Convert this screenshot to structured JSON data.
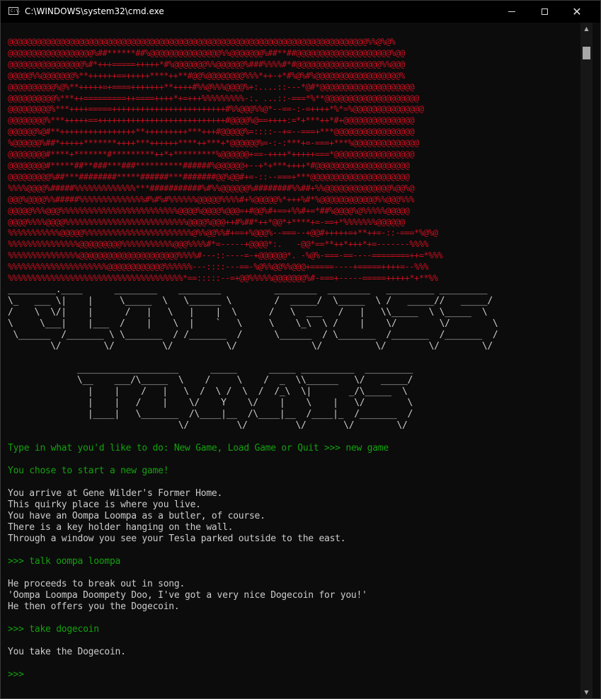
{
  "window": {
    "title": "C:\\WINDOWS\\system32\\cmd.exe",
    "app_icon_text": "C:\\."
  },
  "colors": {
    "art": "#c50f1f",
    "prompt": "#13a10e",
    "text": "#cccccc",
    "background": "#0c0c0c"
  },
  "art": "@@@@@@@@@@@@@@@@@@@@@@@@@@@@@@@@@@@@@@@@@@@@@@@@@@@@@@@@@@@@@@@@@@@@@@@@@@@@%%@%@%\n@@@@@@@@@@@@@@@@@@%##******##%@@@@@@@@@@@@@@@%%@@@@@@@%##**##@@@@@@@@@@@@@@@@@@@@%@@\n@@@@@@@@@@@@@@@@%#*+++=====+++++*#%@@@@@@@%%@@@@@@%###%%%%#*#@@@@@@@@@@@@@@@@@@%%@@@\n@@@@@%%@@@@@@@%**++++++==+++++****++**#@@%@@@@@@@@%%%*++-+*#%@%#%@@@@@@@@@@@@@@@@@@%\n@@@@@@@@@@%@%**+++++=+====+++++++**++++#%%@%%%@@@@%+:....::---*@#*@@@@@@@@@@@@@@@@@@@@\n@@@@@@@@@@%***++=========++====++++*+=+++%%%%%%%%%-:. ...::-===*%**@@@@@@@@@@@@@@@@@@@@\n@@@@@@@@@%***++++=====++++++++++++++++++++++++#%%@@@%%@*--==-:-=++++*%*=%@@@@@@@@@@@@@@@\n@@@@@@@@%***+++++==+++++++++++++++++++++++++++#@@@@%@==++++:=*+***++*#+@@@@@@@@@@@@@@@\n@@@@@@%@#**++++++++++++++++**+++++++++***+++#@@@@@%=::::--+=--===+***@@@@@@@@@@@@@@@@@\n%@@@@@@%##*+++++*******++++***++++++****++***+*@@@@@@%=-:-:***+=-===+***%@@@@@@@@@@@@@@\n@@@@@@@@#****+*******#*********++*+*********%@@@@@@+==-++++*+++++===*@@@@@@@@@@@@@@@@@\n@@@@@@@@#*****##**###***###**********######%@@@@@@+--+*+***++++*#@@@@@@@@@@@@@@@@@@@@\n@@@@@@@@@%##***########*****######***#######@@%@@#+=-::--===+***@@@@@@@@@@@@@@@@@@@@@\n%%%%@@@@%#####%%%%%%%%%%%%%***###########%#%%@@@@@@%########%%##+%%@@@@@@@@@@@@@@%@@%@\n@@@%@@@@%%#####%%%%%%%%%%%%%%#%#%#%%%%%%@@@@@%%%%#+%@@@@@%*+++%#*%@@@@@@@@@@@@%%@@@%%%\n@@@@@%%%@@@%%%%%%%%%%%%%%%%%%%%%%%%%@@@@%@@@@%@@@=+#@@%#+==+%%#+=*##%@@@@%@%%%%%@@@@@\n@@@@%%%%@@@@%%%%%%%%%%%%%%%%%%%%%%%%%%@@@@%@@@++#%##*++*@@*+****+=-==+*%%%%%%%@@@@@@\n%%%%%%%%%%%@@@@@%%%%%%%%%%%%%%%%%%%%%%%@%%@@%%#+==+%@@@%--===--+@@#+++++=+**++=-::-===*%@%@\n%%%%%%%%%%%%%%%@@@@@@@@@%%%%%%%%%%%@@@%%%%#*=-----+@@@@*:.   -@@*==**++*+++*+=-------%%%%\n%%%%%%%%%%%%%%%@@@@@@@@@@@@@@@@@@@@@%%%%#---::----=-+@@@@@@*. -%@%-===-==----========++=*%%%\n%%%%%%%%%%%%%%%%%%%%%@@@@@@@@@@@@%%%%%%---::::---==-%@%%@@%%@@@+=====----+=====++++=--%%%\n%%%%%%%%%%%%%%%%%%%%%%%%%%%%%%%%%%%%%*==:::::--=+@@%%%%%@@@@@@@%#-===+-----=====+++++*+**%%",
  "logo": "_________.____      ________    ________          ________  ________   _________ _________\n\\_   ___ \\|    |     \\_____  \\   \\______ \\        /  _____/  \\_____  \\ /   _____//   _____/\n/    \\  \\/|    |      /   |   \\   |    |  \\      /   \\  ___   /   |   \\\\_____  \\ \\_____  \\\n\\     \\___|    |___  /    |    \\  |    `   \\     \\    \\_\\  \\ /    |    \\/        \\/        \\\n \\______  /_______ \\ \\_______  / /_______  /      \\______  / \\_______  /_______  /_______  /\n        \\/        \\/         \\/          \\/              \\/          \\/        \\/        \\/\n\n             ___________________      _____      _____ __________  _________\n             \\__    ___/\\_____  \\    /     \\    /  _  \\\\______   \\/   _____/\n               |    |    /   |   \\  /  \\ /  \\  /  /_\\  \\|       _/\\_____  \\\n               |    |   /    |    \\/    Y    \\/    |    \\    |   \\/        \\\n               |____|   \\_______  /\\____|__  /\\____|__  /____|_  /_______  /\n                                \\/         \\/         \\/       \\/        \\/",
  "console": {
    "prompt_question": "Type in what you'd like to do: New Game, Load Game or Quit >>> new game",
    "chose_new_game": "You chose to start a new game!",
    "desc_1": "You arrive at Gene Wilder's Former Home.",
    "desc_2": "This quirky place is where you live.",
    "desc_3": "You have an Oompa Loompa as a butler, of course.",
    "desc_4": "There is a key holder hanging on the wall.",
    "desc_5": "Through a window you see your Tesla parked outside to the east.",
    "cmd_1": ">>> talk oompa loompa",
    "resp_1a": "He proceeds to break out in song.",
    "resp_1b": "'Oompa Loompa Doompety Doo, I've got a very nice Dogecoin for you!'",
    "resp_1c": "He then offers you the Dogecoin.",
    "cmd_2": ">>> take dogecoin",
    "resp_2": "You take the Dogecoin.",
    "cmd_3": ">>>"
  }
}
